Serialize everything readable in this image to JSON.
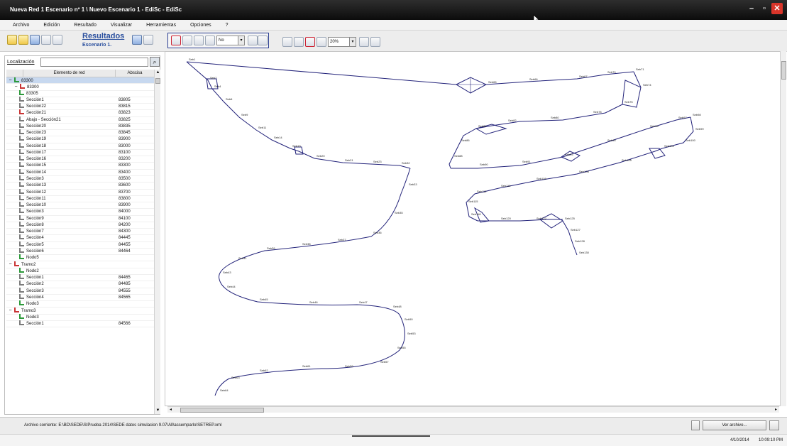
{
  "window": {
    "title": "Nueva Red 1 Escenario nº 1 \\ Nuevo Escenario 1 - EdiSc - EdiSc",
    "minimize_glyph": "–",
    "maximize_glyph": "▫",
    "close_glyph": "✕"
  },
  "menu": [
    "Archivo",
    "Edición",
    "Resultado",
    "Visualizar",
    "Herramientas",
    "Opciones",
    "?"
  ],
  "toolbar": {
    "results_title": "Resultados",
    "scenario_label": "Escenario 1.",
    "view_combo_value": "No",
    "zoom_combo_value": "20%"
  },
  "sidebar": {
    "location_label": "Localización",
    "location_value": "",
    "search_glyph": "⌕",
    "col_element": "Elemento de red",
    "col_abscisa": "Abscisa",
    "rows": [
      {
        "indent": 0,
        "expander": "−",
        "icon": "green",
        "name": "83300",
        "abs": "",
        "sel": true
      },
      {
        "indent": 1,
        "expander": "−",
        "icon": "red",
        "name": "83300",
        "abs": ""
      },
      {
        "indent": 2,
        "expander": "",
        "icon": "green",
        "name": "83305",
        "abs": ""
      },
      {
        "indent": 2,
        "expander": "",
        "icon": "gray",
        "name": "Sección1",
        "abs": "83805"
      },
      {
        "indent": 2,
        "expander": "",
        "icon": "gray",
        "name": "Sección22",
        "abs": "83815"
      },
      {
        "indent": 2,
        "expander": "",
        "icon": "red",
        "name": "Sección21",
        "abs": "83823"
      },
      {
        "indent": 2,
        "expander": "",
        "icon": "gray",
        "name": "Abajo - Sección21",
        "abs": "83825"
      },
      {
        "indent": 2,
        "expander": "",
        "icon": "gray",
        "name": "Sección20",
        "abs": "83835"
      },
      {
        "indent": 2,
        "expander": "",
        "icon": "gray",
        "name": "Sección23",
        "abs": "83845"
      },
      {
        "indent": 2,
        "expander": "",
        "icon": "gray",
        "name": "Sección19",
        "abs": "83900"
      },
      {
        "indent": 2,
        "expander": "",
        "icon": "gray",
        "name": "Sección18",
        "abs": "83000"
      },
      {
        "indent": 2,
        "expander": "",
        "icon": "gray",
        "name": "Sección17",
        "abs": "83100"
      },
      {
        "indent": 2,
        "expander": "",
        "icon": "gray",
        "name": "Sección16",
        "abs": "83200"
      },
      {
        "indent": 2,
        "expander": "",
        "icon": "gray",
        "name": "Sección15",
        "abs": "83300"
      },
      {
        "indent": 2,
        "expander": "",
        "icon": "gray",
        "name": "Sección14",
        "abs": "83400"
      },
      {
        "indent": 2,
        "expander": "",
        "icon": "gray",
        "name": "Sección3",
        "abs": "83500"
      },
      {
        "indent": 2,
        "expander": "",
        "icon": "gray",
        "name": "Sección13",
        "abs": "83600"
      },
      {
        "indent": 2,
        "expander": "",
        "icon": "gray",
        "name": "Sección12",
        "abs": "83700"
      },
      {
        "indent": 2,
        "expander": "",
        "icon": "gray",
        "name": "Sección11",
        "abs": "83800"
      },
      {
        "indent": 2,
        "expander": "",
        "icon": "gray",
        "name": "Sección10",
        "abs": "83900"
      },
      {
        "indent": 2,
        "expander": "",
        "icon": "gray",
        "name": "Sección3",
        "abs": "84000"
      },
      {
        "indent": 2,
        "expander": "",
        "icon": "gray",
        "name": "Sección9",
        "abs": "84100"
      },
      {
        "indent": 2,
        "expander": "",
        "icon": "gray",
        "name": "Sección8",
        "abs": "84200"
      },
      {
        "indent": 2,
        "expander": "",
        "icon": "gray",
        "name": "Sección7",
        "abs": "84300"
      },
      {
        "indent": 2,
        "expander": "",
        "icon": "gray",
        "name": "Sección4",
        "abs": "84445"
      },
      {
        "indent": 2,
        "expander": "",
        "icon": "gray",
        "name": "Sección5",
        "abs": "84455"
      },
      {
        "indent": 2,
        "expander": "",
        "icon": "gray",
        "name": "Sección6",
        "abs": "84464"
      },
      {
        "indent": 2,
        "expander": "",
        "icon": "green",
        "name": "Nodo5",
        "abs": ""
      },
      {
        "indent": 0,
        "expander": "−",
        "icon": "red",
        "name": "Tramo2",
        "abs": ""
      },
      {
        "indent": 2,
        "expander": "",
        "icon": "green",
        "name": "Nodo2",
        "abs": ""
      },
      {
        "indent": 2,
        "expander": "",
        "icon": "gray",
        "name": "Sección1",
        "abs": "84465"
      },
      {
        "indent": 2,
        "expander": "",
        "icon": "gray",
        "name": "Sección2",
        "abs": "84485"
      },
      {
        "indent": 2,
        "expander": "",
        "icon": "gray",
        "name": "Sección3",
        "abs": "84555"
      },
      {
        "indent": 2,
        "expander": "",
        "icon": "gray",
        "name": "Sección4",
        "abs": "84565"
      },
      {
        "indent": 2,
        "expander": "",
        "icon": "green",
        "name": "Nodo3",
        "abs": ""
      },
      {
        "indent": 0,
        "expander": "−",
        "icon": "red",
        "name": "Tramo3",
        "abs": ""
      },
      {
        "indent": 2,
        "expander": "",
        "icon": "green",
        "name": "Nodo3",
        "abs": ""
      },
      {
        "indent": 2,
        "expander": "",
        "icon": "gray",
        "name": "Sección1",
        "abs": "84566"
      }
    ]
  },
  "network_labels": [
    "Seb1",
    "Seb7",
    "Seb4",
    "Seb6",
    "Seb9",
    "Seb11",
    "Seb14",
    "Seb19",
    "Seb20",
    "Seb21",
    "Seb23",
    "Seb32",
    "Seb33",
    "Seb35",
    "Seb36",
    "Seb37",
    "Seb38",
    "Seb39",
    "Seb41",
    "Seb43",
    "Seb44",
    "Seb45",
    "Seb46",
    "Seb47",
    "Seb48",
    "Seb50",
    "Seb53",
    "Seb55",
    "Seb57",
    "Seb59",
    "Seb61",
    "Seb62",
    "Seb63",
    "Seb64",
    "Seb65",
    "Seb66",
    "Seb67",
    "Seb70",
    "Seb71",
    "Seb74",
    "Seb75",
    "Seb78",
    "Seb80",
    "Seb82",
    "Seb84",
    "Seb86",
    "Seb88",
    "Seb90",
    "Seb91",
    "Seb93",
    "Seb95",
    "Seb96",
    "Seb97",
    "Seb98",
    "Seb99",
    "Seb100",
    "Seb102",
    "Seb105",
    "Seb108",
    "Seb109",
    "Seb110",
    "Seb112",
    "Seb115",
    "Seb118",
    "Seb120",
    "Seb122",
    "Seb125",
    "Seb127",
    "Seb128",
    "Seb130"
  ],
  "status": {
    "path_text": "Archivo corriente: E:\\BD\\SEDE\\SIPrueba 2014\\SEDE datos simulacion 9.07\\All\\assemparlo\\SETREP.xml",
    "buttons": [
      "",
      "Ver archivo...",
      ""
    ]
  },
  "taskbar": {
    "date": "4/10/2014",
    "time": "10:09:10 PM"
  }
}
